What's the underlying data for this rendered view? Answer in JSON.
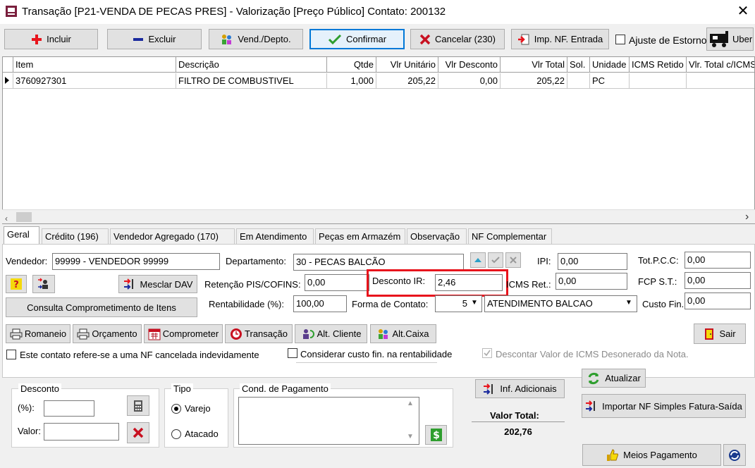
{
  "window": {
    "title": "Transação [P21-VENDA DE PECAS PRES] - Valorização [Preço Público]  Contato: 200132",
    "close_label": "✕"
  },
  "toolbar": {
    "incluir": "Incluir",
    "excluir": "Excluir",
    "vend_depto": "Vend./Depto.",
    "confirmar": "Confirmar",
    "cancelar": "Cancelar (230)",
    "imp_nf": "Imp. NF. Entrada",
    "ajuste_estorno": "Ajuste de Estorno",
    "uber": "Uber"
  },
  "grid": {
    "columns": [
      "Item",
      "Descrição",
      "Qtde",
      "Vlr Unitário",
      "Vlr Desconto",
      "Vlr Total",
      "Sol.",
      "Unidade",
      "ICMS Retido",
      "Vlr. Total c/ICMS"
    ],
    "rows": [
      [
        "3760927301",
        "FILTRO DE COMBUSTIVEL",
        "1,000",
        "205,22",
        "0,00",
        "205,22",
        "",
        "PC",
        "",
        ""
      ]
    ]
  },
  "tabs": [
    "Geral",
    "Crédito (196)",
    "Vendedor Agregado (170)",
    "Em Atendimento",
    "Peças em Armazém",
    "Observação",
    "NF Complementar"
  ],
  "form": {
    "vendedor_label": "Vendedor:",
    "vendedor_value": "99999 - VENDEDOR 99999",
    "departamento_label": "Departamento:",
    "departamento_value": "30 - PECAS BALCÃO",
    "ipi_label": "IPI:",
    "ipi_value": "0,00",
    "totpcc_label": "Tot.P.C.C:",
    "totpcc_value": "0,00",
    "mesclar_dav": "Mesclar DAV",
    "retencao_label": "Retenção PIS/COFINS:",
    "retencao_value": "0,00",
    "desconto_ir_label": "Desconto IR:",
    "desconto_ir_value": "2,46",
    "icms_ret_label": "ICMS Ret.:",
    "icms_ret_value": "0,00",
    "fcp_label": "FCP S.T.:",
    "fcp_value": "0,00",
    "consulta_btn": "Consulta Comprometimento de Itens",
    "rentabilidade_label": "Rentabilidade (%):",
    "rentabilidade_value": "100,00",
    "forma_contato_label": "Forma de Contato:",
    "forma_contato_code": "5",
    "forma_contato_desc": "ATENDIMENTO BALCAO",
    "custo_fin_label": "Custo Fin.",
    "custo_fin_value": "0,00"
  },
  "actions": {
    "romaneio": "Romaneio",
    "orcamento": "Orçamento",
    "comprometer": "Comprometer",
    "transacao": "Transação",
    "alt_cliente": "Alt. Cliente",
    "alt_caixa": "Alt.Caixa",
    "sair": "Sair"
  },
  "checks": {
    "nf_cancelada": "Este contato refere-se a uma NF cancelada indevidamente",
    "custo_fin": "Considerar custo fin. na rentabilidade",
    "descontar_icms": "Descontar Valor de ICMS Desonerado da Nota."
  },
  "bottom": {
    "desconto_title": "Desconto",
    "pct_label": "(%):",
    "valor_label": "Valor:",
    "tipo_title": "Tipo",
    "varejo": "Varejo",
    "atacado": "Atacado",
    "cond_pagamento_title": "Cond. de Pagamento",
    "inf_adicionais": "Inf. Adicionais",
    "valor_total_label": "Valor Total:",
    "valor_total_value": "202,76",
    "atualizar": "Atualizar",
    "importar_nf": "Importar NF Simples Fatura-Saída",
    "meios_pagamento": "Meios Pagamento"
  },
  "colors": {
    "accent": "#0078d7",
    "highlight": "#e8141c"
  }
}
